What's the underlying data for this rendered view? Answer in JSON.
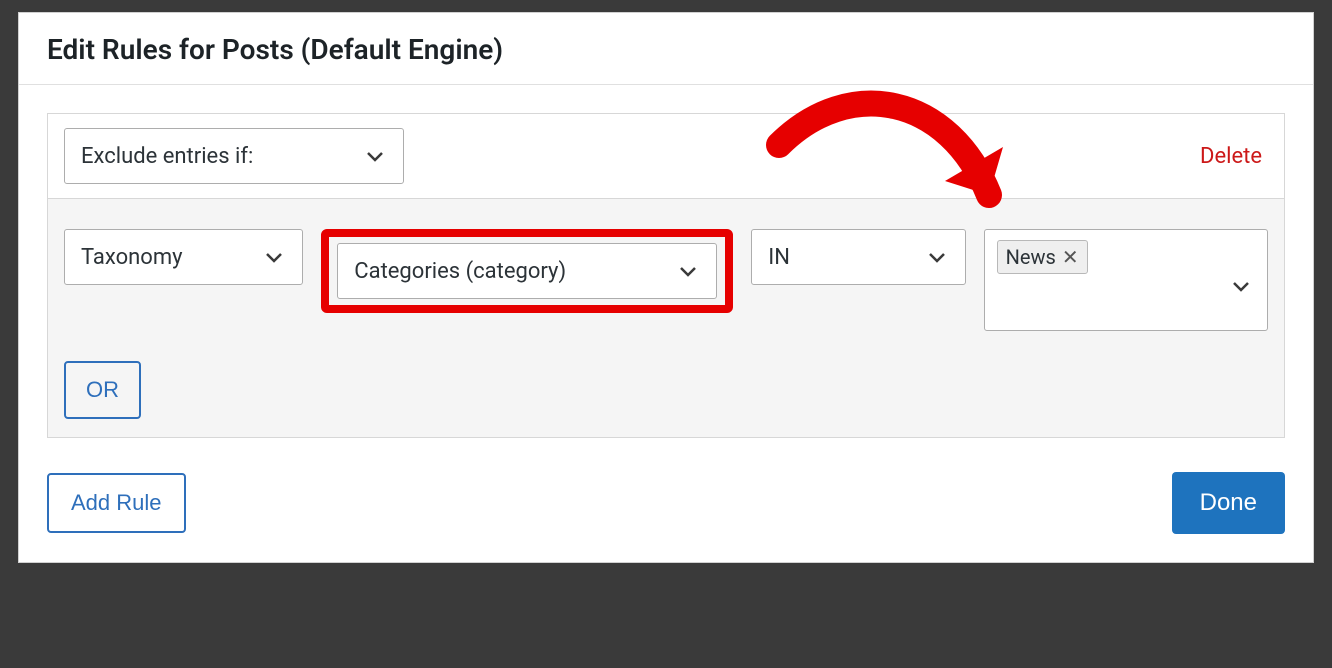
{
  "modal": {
    "title": "Edit Rules for Posts (Default Engine)",
    "footer": {
      "add_rule_label": "Add Rule",
      "done_label": "Done"
    }
  },
  "rule": {
    "condition_label": "Exclude entries if:",
    "delete_label": "Delete",
    "attribute_label": "Taxonomy",
    "taxonomy_label": "Categories (category)",
    "operator_label": "IN",
    "or_label": "OR",
    "tags": [
      {
        "label": "News"
      }
    ]
  },
  "colors": {
    "highlight": "#e60000",
    "primary": "#1e73be",
    "link_blue": "#2e6fbb",
    "danger": "#cc1818"
  }
}
